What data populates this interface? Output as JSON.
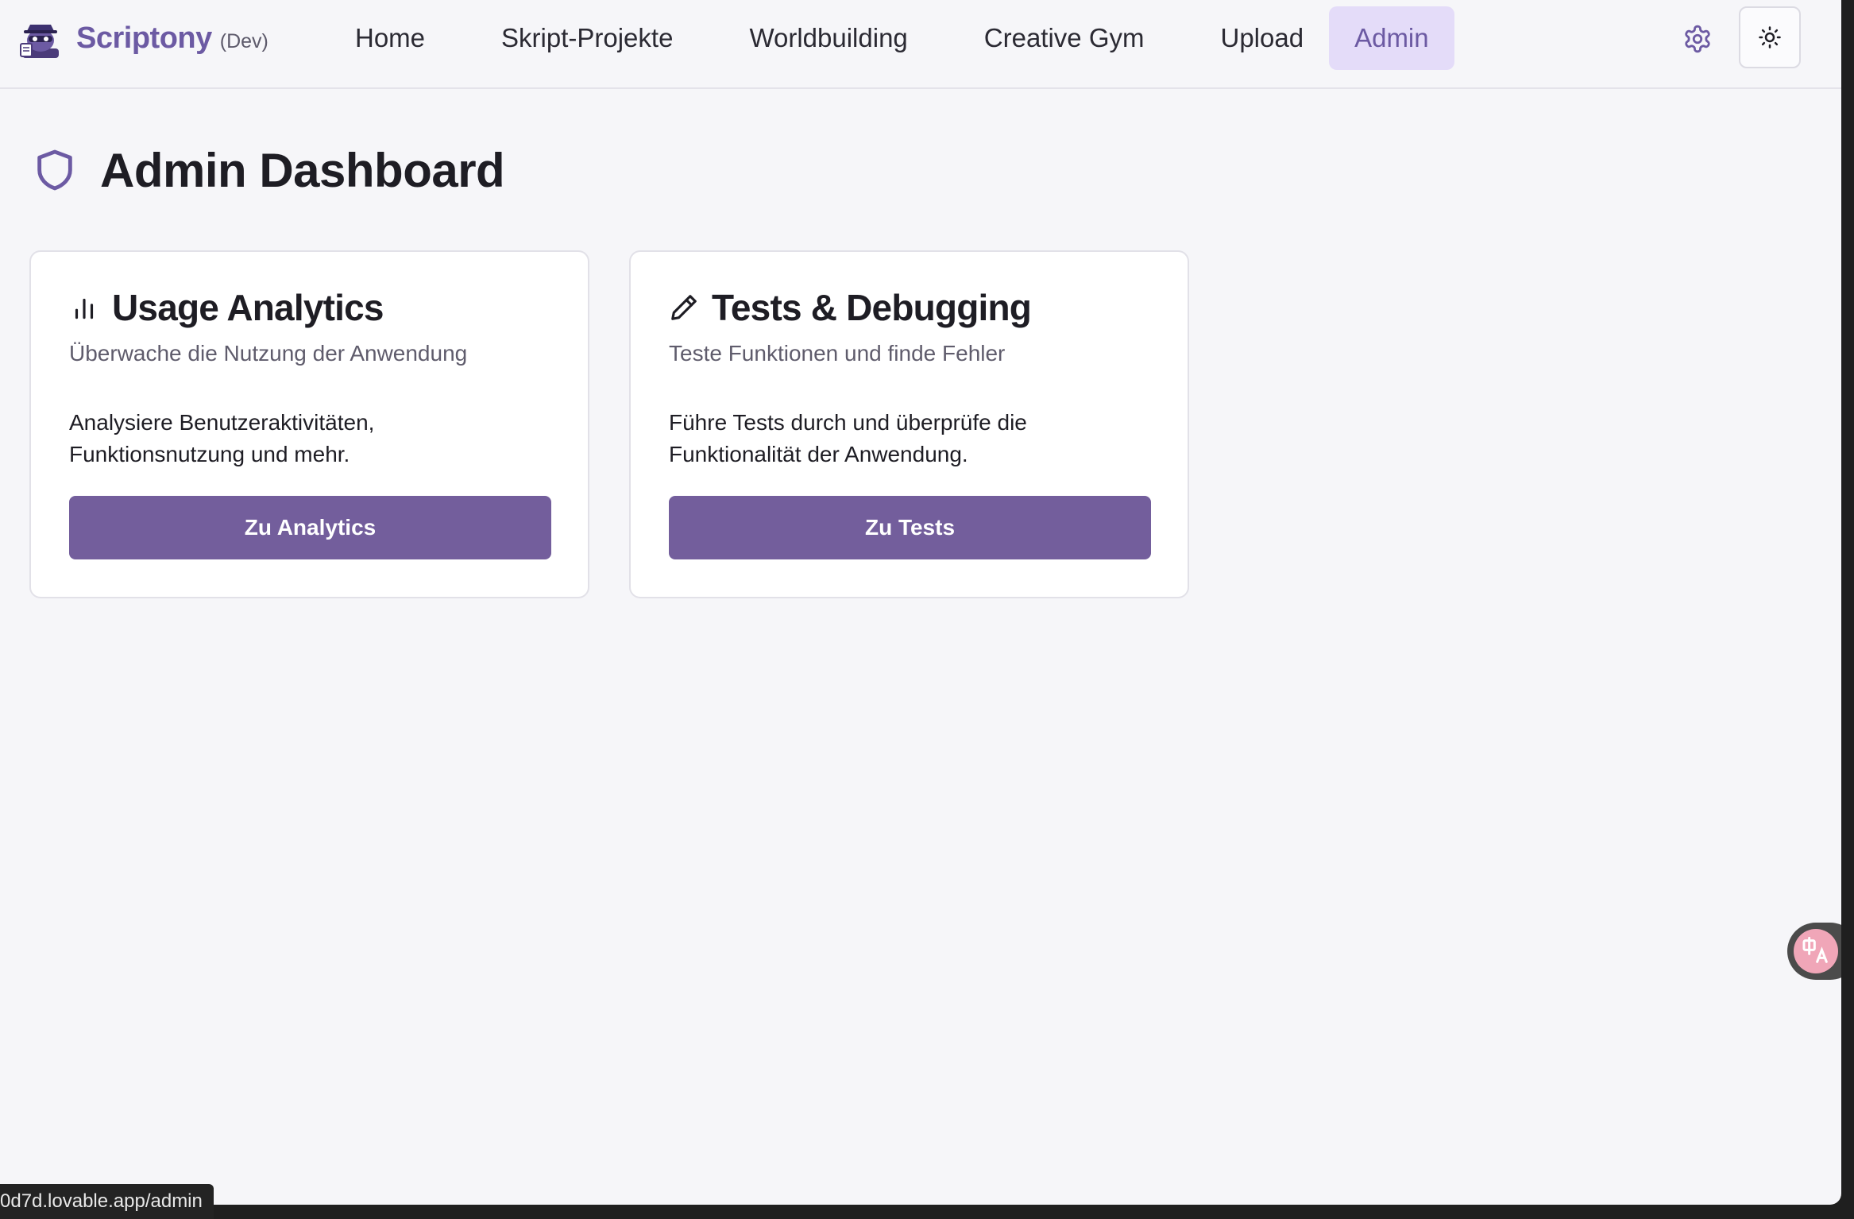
{
  "app": {
    "brand": "Scriptony",
    "env_tag": "(Dev)"
  },
  "nav": {
    "items": [
      {
        "label": "Home"
      },
      {
        "label": "Skript-Projekte"
      },
      {
        "label": "Worldbuilding"
      },
      {
        "label": "Creative Gym"
      },
      {
        "label": "Upload"
      },
      {
        "label": "Admin",
        "active": true
      }
    ]
  },
  "page": {
    "title": "Admin Dashboard"
  },
  "cards": [
    {
      "title": "Usage Analytics",
      "subtitle": "Überwache die Nutzung der Anwendung",
      "body": "Analysiere Benutzeraktivitäten, Funktionsnutzung und mehr.",
      "button": "Zu Analytics",
      "icon": "bar-chart-icon"
    },
    {
      "title": "Tests & Debugging",
      "subtitle": "Teste Funktionen und finde Fehler",
      "body": "Führe Tests durch und überprüfe die Funktionalität der Anwendung.",
      "button": "Zu Tests",
      "icon": "pen-icon"
    }
  ],
  "status_bar": {
    "url": "0d7d.lovable.app/admin"
  },
  "colors": {
    "accent": "#735e9c",
    "brand": "#6c5aa3",
    "active_nav_bg": "#e4dcf9",
    "background": "#f6f6f9"
  }
}
